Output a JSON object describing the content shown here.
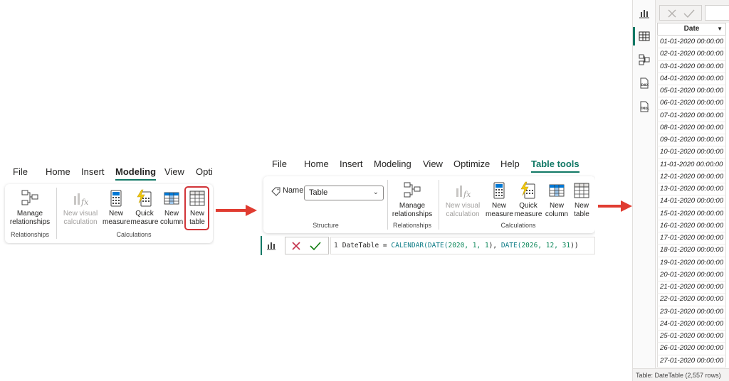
{
  "panel1": {
    "tabs": [
      "File",
      "Home",
      "Insert",
      "Modeling",
      "View",
      "Opti"
    ],
    "active_tab": "Modeling",
    "buttons": {
      "manage_relationships": "Manage relationships",
      "new_visual_calculation": "New visual calculation",
      "new_measure": "New measure",
      "quick_measure": "Quick measure",
      "new_column": "New column",
      "new_table": "New table"
    },
    "groups": {
      "relationships": "Relationships",
      "calculations": "Calculations"
    }
  },
  "panel2": {
    "tabs": [
      "File",
      "Home",
      "Insert",
      "Modeling",
      "View",
      "Optimize",
      "Help",
      "Table tools"
    ],
    "active_tab": "Table tools",
    "name_label": "Name",
    "name_value": "Table",
    "buttons": {
      "manage_relationships": "Manage relationships",
      "new_visual_calculation": "New visual calculation",
      "new_measure": "New measure",
      "quick_measure": "Quick measure",
      "new_column": "New column",
      "new_table": "New table"
    },
    "groups": {
      "structure": "Structure",
      "relationships": "Relationships",
      "calculations": "Calculations"
    },
    "formula": {
      "line_number": "1",
      "prefix": "DateTable = ",
      "fn1": "CALENDAR(",
      "fn2": "DATE(",
      "args1": "2020, 1, 1",
      "sep": "), ",
      "args2": "2026, 12, 31",
      "close": "))"
    }
  },
  "panel3": {
    "column_header": "Date",
    "rows": [
      "01-01-2020 00:00:00",
      "02-01-2020 00:00:00",
      "03-01-2020 00:00:00",
      "04-01-2020 00:00:00",
      "05-01-2020 00:00:00",
      "06-01-2020 00:00:00",
      "07-01-2020 00:00:00",
      "08-01-2020 00:00:00",
      "09-01-2020 00:00:00",
      "10-01-2020 00:00:00",
      "11-01-2020 00:00:00",
      "12-01-2020 00:00:00",
      "13-01-2020 00:00:00",
      "14-01-2020 00:00:00",
      "15-01-2020 00:00:00",
      "16-01-2020 00:00:00",
      "17-01-2020 00:00:00",
      "18-01-2020 00:00:00",
      "19-01-2020 00:00:00",
      "20-01-2020 00:00:00",
      "21-01-2020 00:00:00",
      "22-01-2020 00:00:00",
      "23-01-2020 00:00:00",
      "24-01-2020 00:00:00",
      "25-01-2020 00:00:00",
      "26-01-2020 00:00:00",
      "27-01-2020 00:00:00"
    ],
    "status": "Table: DateTable (2,557 rows)",
    "side_icons": [
      "report-view-icon",
      "table-view-icon",
      "model-view-icon",
      "dax-query-view-icon",
      "tmdl-view-icon"
    ]
  },
  "colors": {
    "accent": "#117865",
    "arrow": "#e03c31",
    "highlight": "#d13438"
  }
}
